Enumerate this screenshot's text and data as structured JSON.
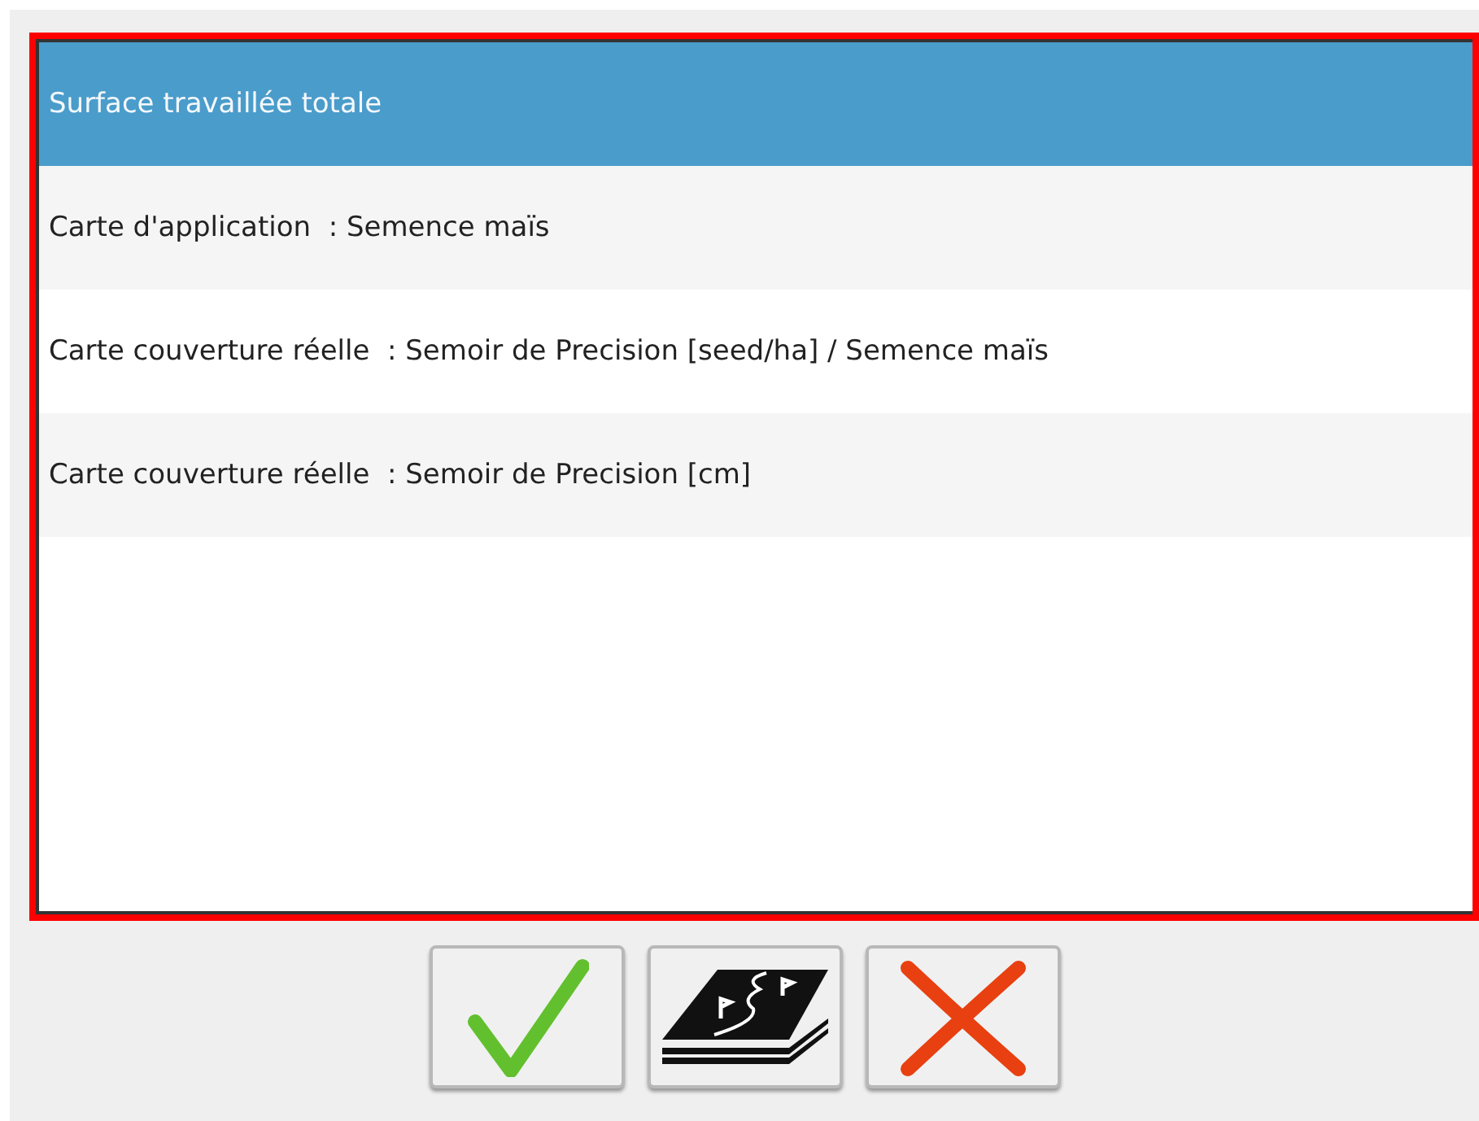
{
  "list": {
    "items": [
      {
        "label": "Surface travaillée totale",
        "selected": true
      },
      {
        "label": "Carte d'application  : Semence maïs",
        "selected": false
      },
      {
        "label": "Carte couverture réelle  : Semoir de Precision [seed/ha] / Semence maïs",
        "selected": false
      },
      {
        "label": "Carte couverture réelle  : Semoir de Precision [cm]",
        "selected": false
      }
    ]
  },
  "buttons": [
    {
      "kind": "confirm"
    },
    {
      "kind": "map"
    },
    {
      "kind": "cancel"
    }
  ]
}
